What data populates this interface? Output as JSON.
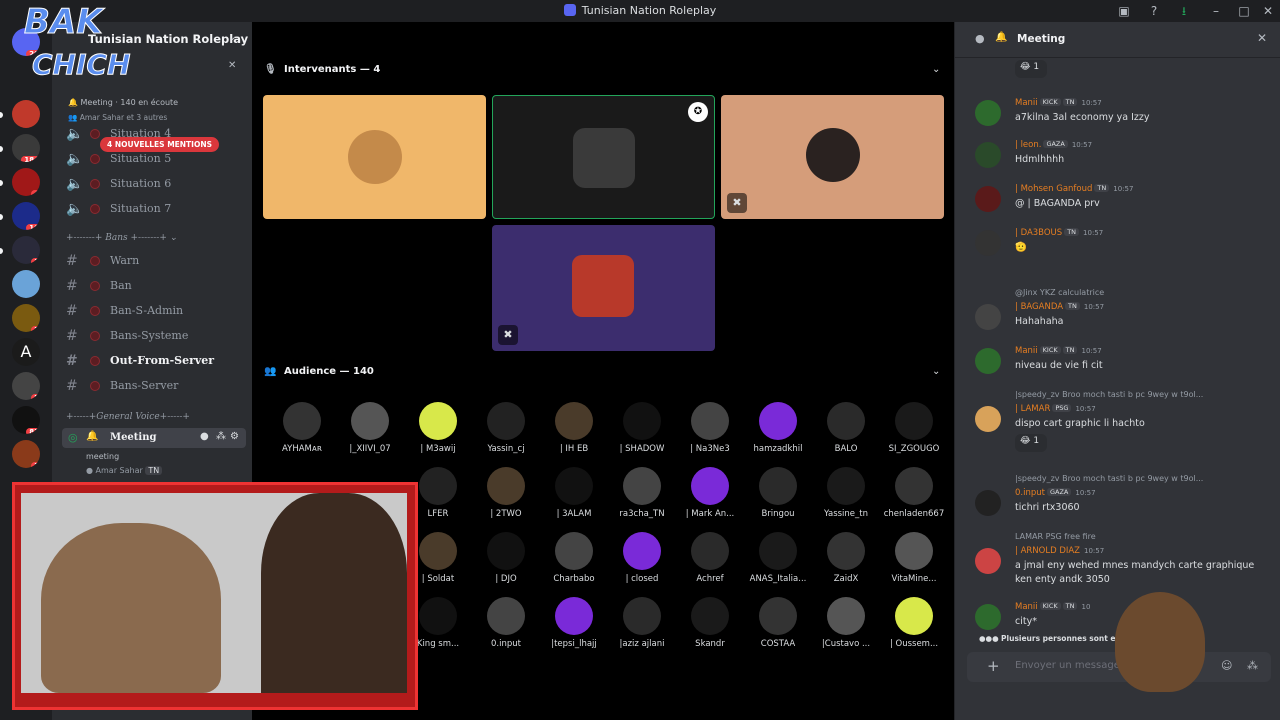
{
  "window": {
    "title": "Tunisian Nation Roleplay"
  },
  "overlay": {
    "logo_line1": "BAK",
    "logo_line2": "CHICH"
  },
  "server": {
    "name": "Tunisian Nation Roleplay"
  },
  "notice": {
    "event_line": "Meeting · 140 en écoute",
    "members": "Amar Sahar et 3 autres"
  },
  "mentions_badge": "4 NOUVELLES MENTIONS",
  "channels_top": [
    {
      "name": "Situation 4"
    },
    {
      "name": "Situation 5"
    },
    {
      "name": "Situation 6"
    },
    {
      "name": "Situation 7"
    }
  ],
  "category_bans": "+-------+ Bans +-------+",
  "channels_bans": [
    {
      "name": "Warn"
    },
    {
      "name": "Ban"
    },
    {
      "name": "Ban-S-Admin"
    },
    {
      "name": "Bans-Systeme"
    },
    {
      "name": "Out-From-Server"
    },
    {
      "name": "Bans-Server"
    }
  ],
  "category_voice": "+-----+General Voice+-----+",
  "voice": {
    "meeting": "Meeting",
    "sub": "meeting",
    "member": "Amar Sahar",
    "member_tag": "TN"
  },
  "stage": {
    "speakers_label": "Intervenants — 4",
    "audience_label": "Audience — 140"
  },
  "audience": [
    [
      "AYHAMᴀʀ",
      "|_XIIVI_07",
      "| M3awij",
      "Yassin_cj",
      "| IH EB",
      "| SHADOW",
      "| Na3Ne3",
      "hamzadkhil",
      "BALO",
      "SI_ZGOUGO"
    ],
    [
      "",
      "",
      "LFER",
      "| 2TWO",
      "| 3ALAM",
      "ra3cha_TN",
      "| Mark An...",
      "Bringou",
      "Yassine_tn",
      "chenladen667"
    ],
    [
      "",
      "",
      "| Soldat",
      "| DJO",
      "Charbabo",
      "| closed",
      "Achref",
      "ANAS_Italia...",
      "ZaidX",
      "VitaMine..."
    ],
    [
      "",
      "",
      "King sm...",
      "0.input",
      "|tepsi_lhajj",
      "|aziz ajlani",
      "Skandr",
      "COSTAA",
      "|Custavo ...",
      "| Oussem..."
    ]
  ],
  "chat": {
    "title": "Meeting",
    "reaction_top": "1",
    "messages": [
      {
        "name": "Manii",
        "tags": [
          "KICK",
          "TN"
        ],
        "time": "10:57",
        "text": "a7kilna 3al economy ya Izzy"
      },
      {
        "name": "| leon.",
        "tags": [
          "GAZA"
        ],
        "time": "10:57",
        "text": "Hdmlhhhh"
      },
      {
        "name": "| Mohsen Ganfoud",
        "tags": [
          "TN"
        ],
        "time": "10:57",
        "text": "@ | BAGANDA prv"
      },
      {
        "name": "| DA3BOUS",
        "tags": [
          "TN"
        ],
        "time": "10:57",
        "text": "🫡"
      },
      {
        "name": "| BAGANDA",
        "tags": [
          "TN"
        ],
        "time": "10:57",
        "text": "Hahahaha",
        "reply": "@Jinx  YKZ  calculatrice"
      },
      {
        "name": "Manii",
        "tags": [
          "KICK",
          "TN"
        ],
        "time": "10:57",
        "text": "niveau de vie fi cit"
      },
      {
        "name": "| LAMAR",
        "tags": [
          "PSG"
        ],
        "time": "10:57",
        "text": "dispo cart graphic li hachto",
        "reply": "|speedy_zv  Broo moch tasti b pc 9wey w t9ol..."
      },
      {
        "name": "0.input",
        "tags": [
          "GAZA"
        ],
        "time": "10:57",
        "text": "tichri rtx3060",
        "reply": "|speedy_zv  Broo moch tasti b pc 9wey w t9ol..."
      },
      {
        "name": "| ARNOLD DIAZ",
        "tags": [],
        "time": "10:57",
        "text": "a jmal eny wehed mnes mandych carte graphique",
        "text2": "ken enty andk 3050",
        "reply": "LAMAR  PSG  free fire"
      },
      {
        "name": "Manii",
        "tags": [
          "KICK",
          "TN"
        ],
        "time": "10",
        "text": "city*"
      }
    ],
    "reaction_mid": "1",
    "typing": "Plusieurs personnes sont en tra...",
    "placeholder": "Envoyer un message à"
  },
  "server_badges": [
    "20",
    "",
    "",
    "184",
    "4",
    "16",
    "1",
    "",
    "3",
    "",
    "5",
    "83",
    "3"
  ]
}
